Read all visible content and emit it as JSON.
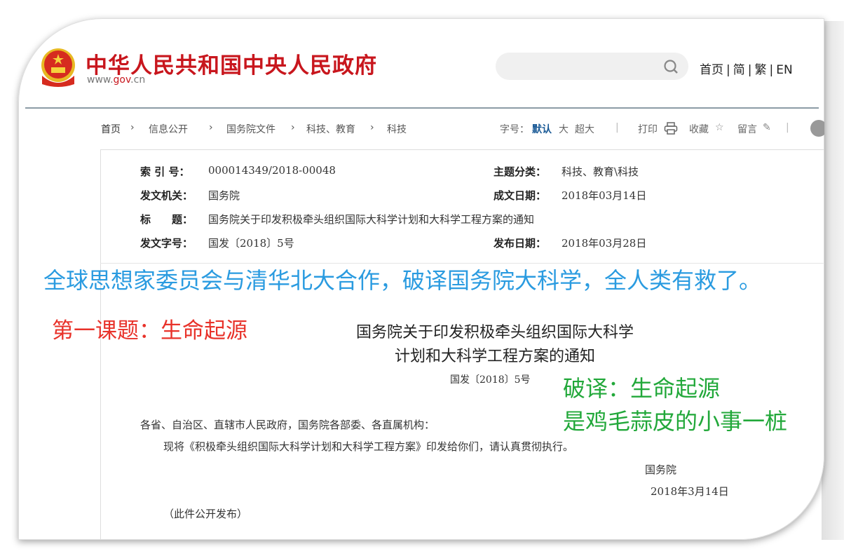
{
  "header": {
    "site_title": "中华人民共和国中央人民政府",
    "site_url_pre": "www.",
    "site_url_mid": "gov",
    "site_url_post": ".cn",
    "search_placeholder": "",
    "nav": [
      "首页",
      "简",
      "繁",
      "EN"
    ]
  },
  "breadcrumb": [
    "首页",
    "信息公开",
    "国务院文件",
    "科技、教育",
    "科技"
  ],
  "toolbar": {
    "font_label": "字号：",
    "font_default": "默认",
    "font_large": "大",
    "font_xlarge": "超大",
    "print": "打印",
    "favorite": "收藏",
    "comment": "留言"
  },
  "info": {
    "index_label": "索 引 号：",
    "index": "000014349/2018-00048",
    "topic_label": "主题分类：",
    "topic": "科技、教育\\科技",
    "issuer_label": "发文机关：",
    "issuer": "国务院",
    "written_label": "成文日期：",
    "written": "2018年03月14日",
    "title_label": "标　　题：",
    "title": "国务院关于印发积极牵头组织国际大科学计划和大科学工程方案的通知",
    "docno_label": "发文字号：",
    "docno": "国发〔2018〕5号",
    "published_label": "发布日期：",
    "published": "2018年03月28日"
  },
  "overlay": {
    "blue": "全球思想家委员会与清华北大合作，破译国务院大科学，全人类有救了。",
    "red": "第一课题：生命起源",
    "green1": "破译：生命起源",
    "green2": "是鸡毛蒜皮的小事一桩"
  },
  "document": {
    "title1": "国务院关于印发积极牵头组织国际大科学",
    "title2": "计划和大科学工程方案的通知",
    "docno": "国发〔2018〕5号",
    "addressee": "各省、自治区、直辖市人民政府，国务院各部委、各直属机构：",
    "body": "现将《积极牵头组织国际大科学计划和大科学工程方案》印发给你们，请认真贯彻执行。",
    "signer": "国务院",
    "date": "2018年3月14日",
    "note": "（此件公开发布）"
  }
}
